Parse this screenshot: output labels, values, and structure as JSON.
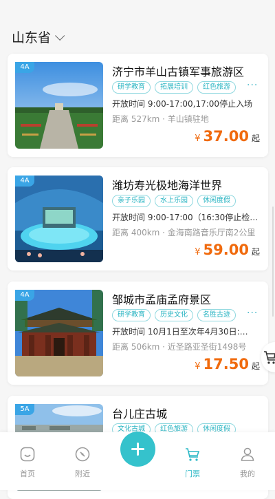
{
  "header": {
    "region": "山东省"
  },
  "items": [
    {
      "level": "4A",
      "title": "济宁市羊山古镇军事旅游区",
      "tags": [
        "研学教育",
        "拓展培训",
        "红色旅游"
      ],
      "more": "···",
      "open": "开放时间 9:00-17:00,17:00停止入场",
      "distance": "距离 527km · 羊山镇驻地",
      "currency": "¥",
      "price": "37.00",
      "price_suffix": "起"
    },
    {
      "level": "4A",
      "title": "潍坊寿光极地海洋世界",
      "tags": [
        "亲子乐园",
        "水上乐园",
        "休闲度假"
      ],
      "more": "",
      "open": "开放时间 9:00-17:00（16:30停止检…",
      "distance": "距离 400km · 金海南路音乐厅南2公里",
      "currency": "¥",
      "price": "59.00",
      "price_suffix": "起"
    },
    {
      "level": "4A",
      "title": "邹城市孟庙孟府景区",
      "tags": [
        "研学教育",
        "历史文化",
        "名胜古迹"
      ],
      "more": "···",
      "open": "开放时间 10月1日至次年4月30日:…",
      "distance": "距离 506km · 近圣路亚圣街1498号",
      "currency": "¥",
      "price": "17.50",
      "price_suffix": "起"
    },
    {
      "level": "5A",
      "title": "台儿庄古城",
      "tags": [
        "文化古城",
        "红色旅游",
        "休闲度假"
      ],
      "more": "",
      "open": "",
      "distance": "",
      "currency": "",
      "price": "",
      "price_suffix": ""
    }
  ],
  "tabbar": {
    "home": "首页",
    "nearby": "附近",
    "tickets": "门票",
    "mine": "我的"
  },
  "colors": {
    "accent": "#35c2cc",
    "price": "#f06a0d",
    "level_badge": "#3aa5e6"
  }
}
